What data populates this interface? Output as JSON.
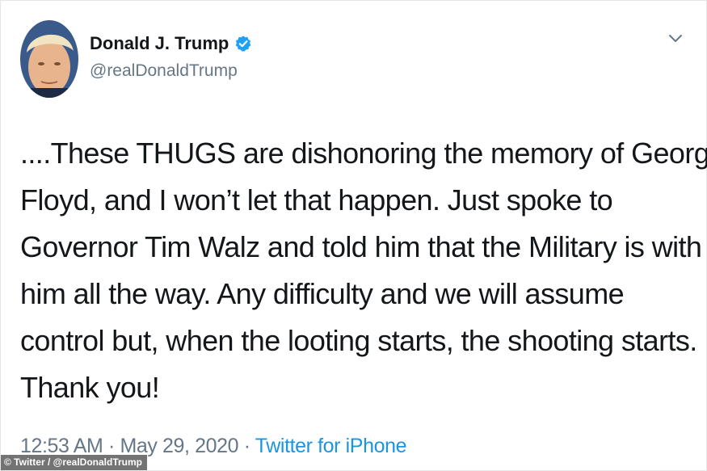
{
  "tweet": {
    "display_name": "Donald J. Trump",
    "handle": "@realDonaldTrump",
    "verified": true,
    "verified_icon": "verified-badge-icon",
    "menu_icon": "chevron-down-icon",
    "text_lines": [
      "....These THUGS are dishonoring the memory of George",
      "Floyd, and I won’t let that happen. Just spoke to",
      "Governor Tim Walz and told him that the Military is with",
      "him all the way. Any difficulty and we will assume",
      "control but, when the looting starts, the shooting starts.",
      "Thank you!"
    ],
    "time": "12:53 AM",
    "separator": "·",
    "date": "May 29, 2020",
    "source": "Twitter for iPhone"
  },
  "credit": "© Twitter / @realDonaldTrump",
  "colors": {
    "text": "#14171a",
    "secondary": "#657786",
    "link": "#1b95e0",
    "verified": "#1da1f2"
  }
}
